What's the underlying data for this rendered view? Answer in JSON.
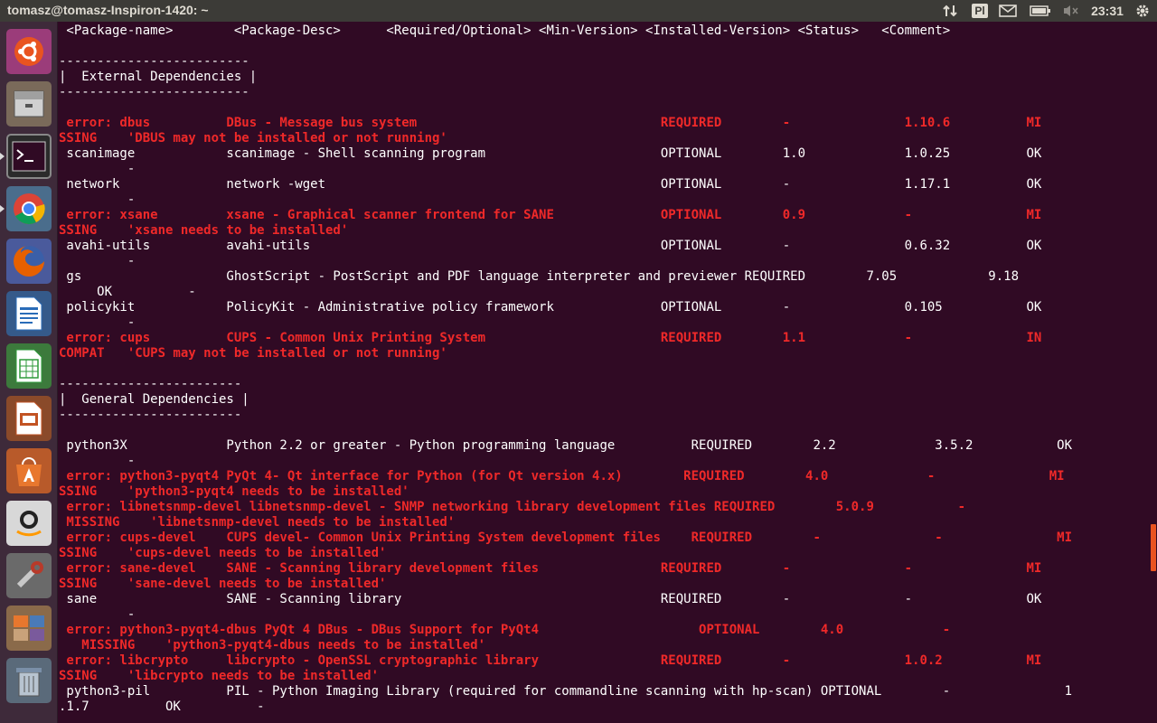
{
  "topbar": {
    "title": "tomasz@tomasz-Inspiron-1420: ~",
    "keyboard_layout": "Pl",
    "clock": "23:31",
    "icons": [
      "network-arrows-icon",
      "mail-icon",
      "battery-icon",
      "volume-muted-icon",
      "gear-icon"
    ]
  },
  "launcher": {
    "items": [
      {
        "name": "ubuntu-dash-icon",
        "color": "#e95420"
      },
      {
        "name": "files-icon",
        "color": "#8a8a8a"
      },
      {
        "name": "terminal-icon",
        "color": "#2b2b2b"
      },
      {
        "name": "chrome-icon",
        "color": "#4285f4"
      },
      {
        "name": "firefox-icon",
        "color": "#e66000"
      },
      {
        "name": "libreoffice-writer-icon",
        "color": "#2a6cb8"
      },
      {
        "name": "libreoffice-calc-icon",
        "color": "#2e9a3a"
      },
      {
        "name": "libreoffice-impress-icon",
        "color": "#c25323"
      },
      {
        "name": "software-center-icon",
        "color": "#e8772e"
      },
      {
        "name": "amazon-icon",
        "color": "#f2f2f2"
      },
      {
        "name": "system-settings-icon",
        "color": "#b83a2a"
      },
      {
        "name": "workspaces-icon",
        "color": "#c9a27a"
      },
      {
        "name": "trash-icon",
        "color": "#7a8fa8"
      }
    ]
  },
  "terminal": {
    "lines": [
      {
        "t": " <Package-name>        <Package-Desc>      <Required/Optional> <Min-Version> <Installed-Version> <Status>   <Comment>",
        "e": false
      },
      {
        "t": "",
        "e": false
      },
      {
        "t": "-------------------------",
        "e": false
      },
      {
        "t": "|  External Dependencies |",
        "e": false
      },
      {
        "t": "-------------------------",
        "e": false
      },
      {
        "t": "",
        "e": false
      },
      {
        "t": " error: dbus          DBus - Message bus system                                REQUIRED        -               1.10.6          MI",
        "e": true
      },
      {
        "t": "SSING    'DBUS may not be installed or not running'",
        "e": true
      },
      {
        "t": " scanimage            scanimage - Shell scanning program                       OPTIONAL        1.0             1.0.25          OK",
        "e": false
      },
      {
        "t": "         -",
        "e": false
      },
      {
        "t": " network              network -wget                                            OPTIONAL        -               1.17.1          OK",
        "e": false
      },
      {
        "t": "         -",
        "e": false
      },
      {
        "t": " error: xsane         xsane - Graphical scanner frontend for SANE              OPTIONAL        0.9             -               MI",
        "e": true
      },
      {
        "t": "SSING    'xsane needs to be installed'",
        "e": true
      },
      {
        "t": " avahi-utils          avahi-utils                                              OPTIONAL        -               0.6.32          OK",
        "e": false
      },
      {
        "t": "         -",
        "e": false
      },
      {
        "t": " gs                   GhostScript - PostScript and PDF language interpreter and previewer REQUIRED        7.05            9.18",
        "e": false
      },
      {
        "t": "     OK          -",
        "e": false
      },
      {
        "t": " policykit            PolicyKit - Administrative policy framework              OPTIONAL        -               0.105           OK",
        "e": false
      },
      {
        "t": "         -",
        "e": false
      },
      {
        "t": " error: cups          CUPS - Common Unix Printing System                       REQUIRED        1.1             -               IN",
        "e": true
      },
      {
        "t": "COMPAT   'CUPS may not be installed or not running'",
        "e": true
      },
      {
        "t": "",
        "e": false
      },
      {
        "t": "------------------------",
        "e": false
      },
      {
        "t": "|  General Dependencies |",
        "e": false
      },
      {
        "t": "------------------------",
        "e": false
      },
      {
        "t": "",
        "e": false
      },
      {
        "t": " python3X             Python 2.2 or greater - Python programming language          REQUIRED        2.2             3.5.2           OK",
        "e": false
      },
      {
        "t": "         -",
        "e": false
      },
      {
        "t": " error: python3-pyqt4 PyQt 4- Qt interface for Python (for Qt version 4.x)        REQUIRED        4.0             -               MI",
        "e": true
      },
      {
        "t": "SSING    'python3-pyqt4 needs to be installed'",
        "e": true
      },
      {
        "t": " error: libnetsnmp-devel libnetsnmp-devel - SNMP networking library development files REQUIRED        5.0.9           -",
        "e": true
      },
      {
        "t": " MISSING    'libnetsnmp-devel needs to be installed'",
        "e": true
      },
      {
        "t": " error: cups-devel    CUPS devel- Common Unix Printing System development files    REQUIRED        -               -               MI",
        "e": true
      },
      {
        "t": "SSING    'cups-devel needs to be installed'",
        "e": true
      },
      {
        "t": " error: sane-devel    SANE - Scanning library development files                REQUIRED        -               -               MI",
        "e": true
      },
      {
        "t": "SSING    'sane-devel needs to be installed'",
        "e": true
      },
      {
        "t": " sane                 SANE - Scanning library                                  REQUIRED        -               -               OK",
        "e": false
      },
      {
        "t": "         -",
        "e": false
      },
      {
        "t": " error: python3-pyqt4-dbus PyQt 4 DBus - DBus Support for PyQt4                     OPTIONAL        4.0             -",
        "e": true
      },
      {
        "t": "   MISSING    'python3-pyqt4-dbus needs to be installed'",
        "e": true
      },
      {
        "t": " error: libcrypto     libcrypto - OpenSSL cryptographic library                REQUIRED        -               1.0.2           MI",
        "e": true
      },
      {
        "t": "SSING    'libcrypto needs to be installed'",
        "e": true
      },
      {
        "t": " python3-pil          PIL - Python Imaging Library (required for commandline scanning with hp-scan) OPTIONAL        -               1",
        "e": false
      },
      {
        "t": ".1.7          OK          -",
        "e": false
      }
    ]
  }
}
